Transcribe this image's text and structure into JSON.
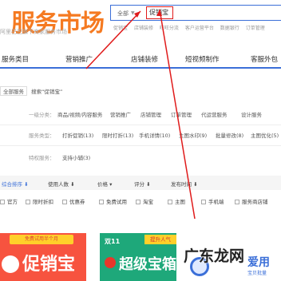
{
  "header": {
    "logo_main": "服务市场",
    "logo_sub": "阿里巴巴旗下商家服务市场",
    "search": {
      "scope": "全部",
      "value": "促销宝"
    },
    "hot_links": [
      "促销宝",
      "店铺装修",
      "旺旺分流",
      "客户运营平台",
      "数据银行",
      "订单管理"
    ]
  },
  "nav": {
    "items": [
      "服务类目",
      "营销推广",
      "店铺装修",
      "短视频制作",
      "客服外包"
    ]
  },
  "breadcrumb": {
    "home": "全部服务",
    "query": "搜索“促销宝”"
  },
  "filters": [
    {
      "label": "一级分类：",
      "options": [
        "商品/视频/内容服务",
        "营销推广",
        "店铺管理",
        "订单管理",
        "代运营服务",
        "设计服务"
      ]
    },
    {
      "label": "服务类型：",
      "options": [
        "打折促销(13)",
        "限时打折(13)",
        "手机详情(10)",
        "主图水印(9)",
        "批量修改(8)",
        "主图优化(5)"
      ]
    },
    {
      "label": "特权服务：",
      "options": [
        "支持小辅(3)"
      ]
    }
  ],
  "sort": {
    "items": [
      "综合排序",
      "使用人数",
      "价格",
      "评分",
      "发布时间"
    ]
  },
  "checkboxes": [
    "官方",
    "限时折扣",
    "优惠券",
    "免费试用",
    "淘宝",
    "主图",
    "手机端",
    "服务商店铺"
  ],
  "cards": [
    {
      "tag": "免费试用半个月",
      "title": "促销宝"
    },
    {
      "tag": "双11",
      "badge": "提升人气",
      "title": "超级宝箱"
    },
    {
      "title": "爱用",
      "sub": "宝贝批量"
    }
  ],
  "watermark": "广东龙网",
  "colors": {
    "accent": "#3b6fd8",
    "logo_orange": "#f57a21",
    "highlight_red": "#e01b1b"
  }
}
